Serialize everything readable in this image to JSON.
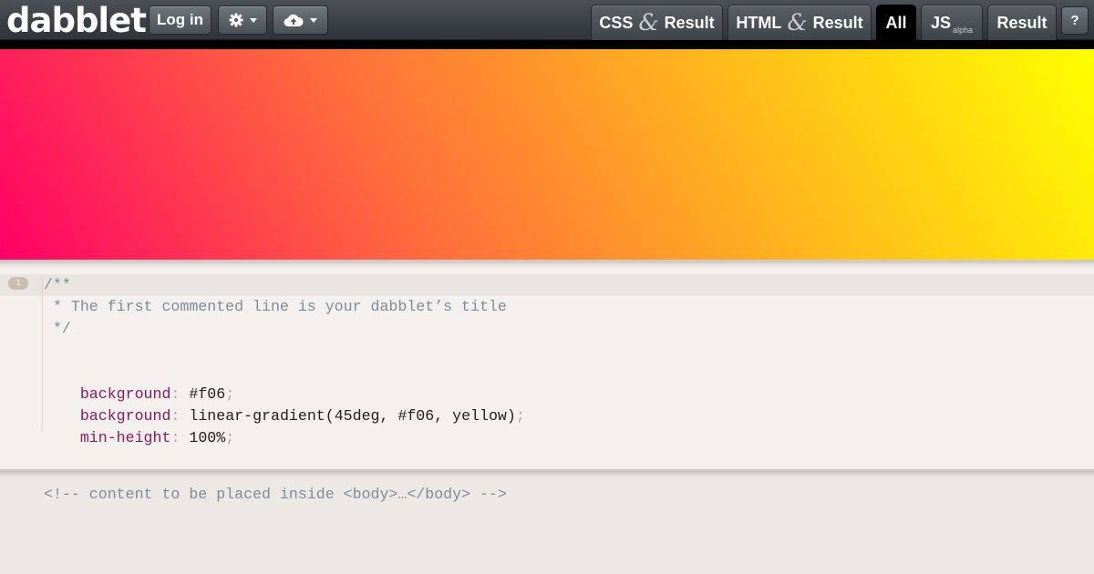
{
  "app": {
    "logo": "dabblet"
  },
  "toolbar": {
    "login_label": "Log in",
    "settings_icon": "gear-icon",
    "cloud_icon": "cloud-upload-icon"
  },
  "tabs": [
    {
      "label": "CSS",
      "amp": "&",
      "label2": "Result"
    },
    {
      "label": "HTML",
      "amp": "&",
      "label2": "Result"
    },
    {
      "label": "All",
      "active": true
    },
    {
      "label": "JS",
      "sub": "alpha"
    },
    {
      "label": "Result"
    }
  ],
  "help_label": "?",
  "result": {
    "gradient": [
      "#ff0066",
      "#ffff00"
    ]
  },
  "css_editor": {
    "line_number": "1",
    "lines": [
      "/**",
      " * The first commented line is your dabblet’s title",
      " */",
      "",
      {
        "prop": "background",
        "colon": ":",
        "value": " #f06",
        "semi": ";"
      },
      {
        "prop": "background",
        "colon": ":",
        "value": " linear-gradient(45deg, #f06, yellow)",
        "semi": ";"
      },
      {
        "prop": "min-height",
        "colon": ":",
        "value": " 100%",
        "semi": ";"
      }
    ]
  },
  "html_editor": {
    "line": "<!-- content to be placed inside <body>…</body> -->"
  }
}
